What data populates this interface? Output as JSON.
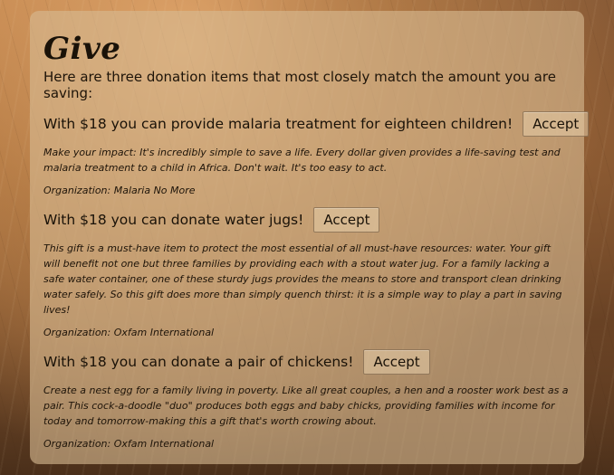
{
  "page": {
    "title": "Give",
    "intro": "Here are three donation items that most closely match the amount you are saving:"
  },
  "items": [
    {
      "title": "With $18 you can provide malaria treatment for eighteen children!",
      "accept_label": "Accept",
      "description": "Make your impact: It's incredibly simple to save a life. Every dollar given provides a life-saving test and malaria treatment to a child in Africa. Don't wait. It's too easy to act.",
      "organization": "Organization: Malaria No More"
    },
    {
      "title": "With $18 you can donate water jugs!",
      "accept_label": "Accept",
      "description": "This gift is a must-have item to protect the most essential of all must-have resources: water. Your gift will benefit not one but three families by providing each with a stout water jug. For a family lacking a safe water container, one of these sturdy jugs provides the means to store and transport clean drinking water safely. So this gift does more than simply quench thirst: it is a simple way to play a part in saving lives!",
      "organization": "Organization: Oxfam International"
    },
    {
      "title": "With $18 you can donate a pair of chickens!",
      "accept_label": "Accept",
      "description": "Create a nest egg for a family living in poverty. Like all great couples, a hen and a rooster work best as a pair. This cock-a-doodle \"duo\" produces both eggs and baby chicks, providing families with income for today and tomorrow-making this a gift that's worth crowing about.",
      "organization": "Organization: Oxfam International"
    }
  ]
}
